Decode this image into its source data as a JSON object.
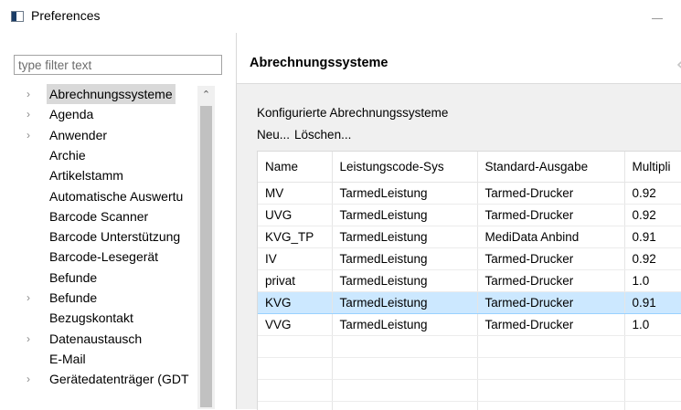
{
  "window": {
    "title": "Preferences"
  },
  "filter": {
    "placeholder": "type filter text"
  },
  "tree": {
    "items": [
      {
        "label": "Abrechnungssysteme",
        "expandable": true,
        "selected": true
      },
      {
        "label": "Agenda",
        "expandable": true,
        "selected": false
      },
      {
        "label": "Anwender",
        "expandable": true,
        "selected": false
      },
      {
        "label": "Archie",
        "expandable": false,
        "selected": false
      },
      {
        "label": "Artikelstamm",
        "expandable": false,
        "selected": false
      },
      {
        "label": "Automatische Auswertu",
        "expandable": false,
        "selected": false
      },
      {
        "label": "Barcode Scanner",
        "expandable": false,
        "selected": false
      },
      {
        "label": "Barcode Unterstützung",
        "expandable": false,
        "selected": false
      },
      {
        "label": "Barcode-Lesegerät",
        "expandable": false,
        "selected": false
      },
      {
        "label": "Befunde",
        "expandable": false,
        "selected": false
      },
      {
        "label": "Befunde",
        "expandable": true,
        "selected": false
      },
      {
        "label": "Bezugskontakt",
        "expandable": false,
        "selected": false
      },
      {
        "label": "Datenaustausch",
        "expandable": true,
        "selected": false
      },
      {
        "label": "E-Mail",
        "expandable": false,
        "selected": false
      },
      {
        "label": "Gerätedatenträger (GDT",
        "expandable": true,
        "selected": false
      }
    ]
  },
  "page": {
    "title": "Abrechnungssysteme",
    "section_label": "Konfigurierte Abrechnungssysteme",
    "actions": {
      "new": "Neu...",
      "delete": "Löschen..."
    }
  },
  "table": {
    "columns": [
      "Name",
      "Leistungscode-Sys",
      "Standard-Ausgabe",
      "Multipli"
    ],
    "rows": [
      [
        "MV",
        "TarmedLeistung",
        "Tarmed-Drucker",
        "0.92"
      ],
      [
        "UVG",
        "TarmedLeistung",
        "Tarmed-Drucker",
        "0.92"
      ],
      [
        "KVG_TP",
        "TarmedLeistung",
        "MediData Anbind",
        "0.91"
      ],
      [
        "IV",
        "TarmedLeistung",
        "Tarmed-Drucker",
        "0.92"
      ],
      [
        "privat",
        "TarmedLeistung",
        "Tarmed-Drucker",
        "1.0"
      ],
      [
        "KVG",
        "TarmedLeistung",
        "Tarmed-Drucker",
        "0.91"
      ],
      [
        "VVG",
        "TarmedLeistung",
        "Tarmed-Drucker",
        "1.0"
      ]
    ],
    "selected_row": 5
  },
  "colors": {
    "selection": "#cce8ff",
    "tree_selection": "#d9d9d9",
    "content_bg": "#f0f0f0"
  },
  "icons": {
    "window": "app-window-icon",
    "expand": "chevron-right-icon",
    "back": "chevron-left-icon",
    "scroll_up": "chevron-up-icon"
  }
}
